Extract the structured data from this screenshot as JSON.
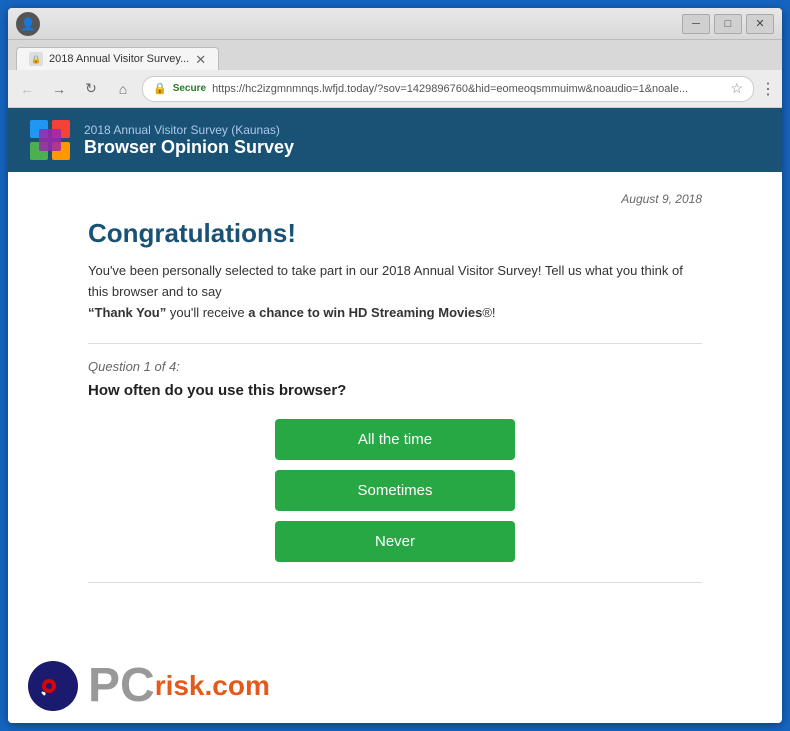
{
  "browser": {
    "tab_label": "2018 Annual Visitor Survey...",
    "url": "https://hc2izgmnmnqs.lwfjd.today/?sov=1429896760&hid=eomeoqsmmuimw&noaudio=1&noale...",
    "secure_text": "Secure",
    "nav": {
      "back": "←",
      "forward": "→",
      "refresh": "↻",
      "home": "⌂"
    },
    "controls": {
      "minimize": "─",
      "maximize": "□",
      "close": "✕"
    }
  },
  "site_header": {
    "subtitle": "2018 Annual Visitor Survey (Kaunas)",
    "title": "Browser Opinion Survey"
  },
  "page": {
    "date": "August 9, 2018",
    "congrats_title": "Congratulations!",
    "intro_paragraph": "You've been personally selected to take part in our 2018 Annual Visitor Survey! Tell us what you think of this browser and to say",
    "thank_you": "“Thank You”",
    "prize_text": "you'll receive",
    "prize_bold": "a chance to win HD Streaming Movies",
    "prize_suffix": "®!",
    "question_label": "Question 1 of 4:",
    "question_text": "How often do you use this browser?",
    "answers": [
      "All the time",
      "Sometimes",
      "Never"
    ]
  },
  "footer": {
    "pc_text": "PC",
    "risk_text": "risk",
    "dot_com": ".com"
  }
}
